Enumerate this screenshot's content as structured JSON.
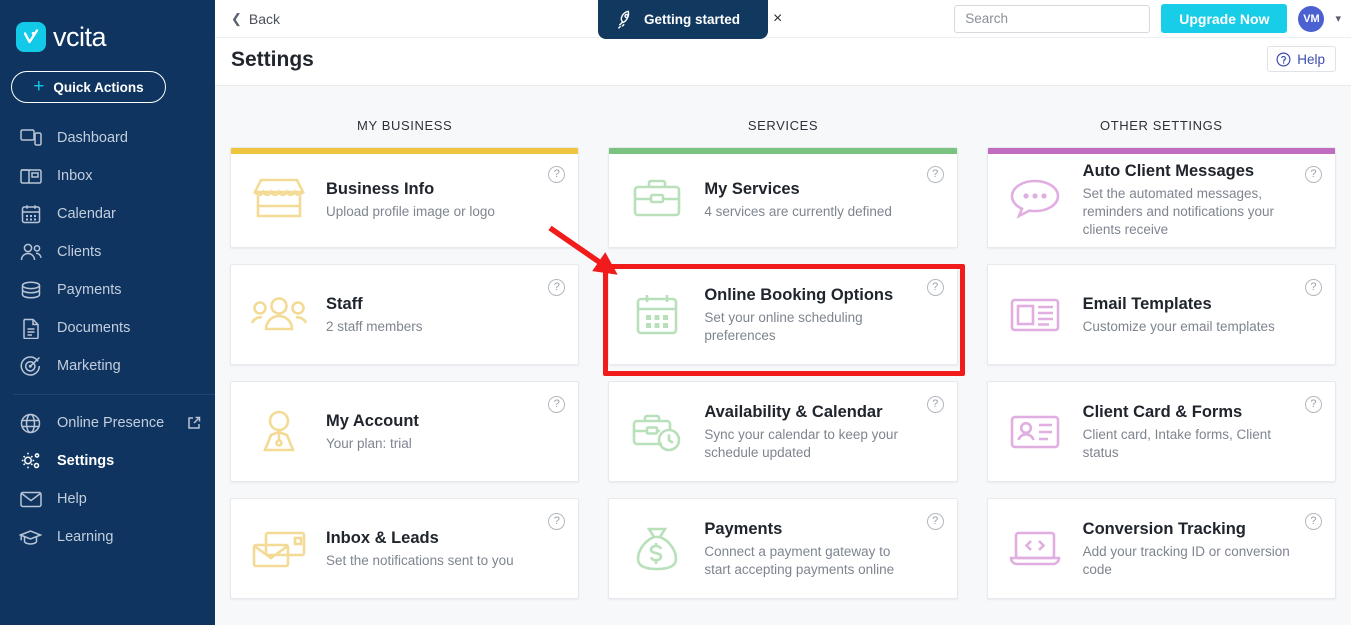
{
  "brand": {
    "name": "vcita",
    "logo_icon": "vcita-logo-icon",
    "accent": "#17cde8"
  },
  "sidebar": {
    "quick_actions": {
      "label": "Quick Actions",
      "icon": "plus-icon"
    },
    "items": [
      {
        "label": "Dashboard",
        "icon": "dashboard-icon",
        "active": false
      },
      {
        "label": "Inbox",
        "icon": "inbox-icon",
        "active": false
      },
      {
        "label": "Calendar",
        "icon": "calendar-icon",
        "active": false
      },
      {
        "label": "Clients",
        "icon": "clients-icon",
        "active": false
      },
      {
        "label": "Payments",
        "icon": "payments-icon",
        "active": false
      },
      {
        "label": "Documents",
        "icon": "documents-icon",
        "active": false
      },
      {
        "label": "Marketing",
        "icon": "marketing-icon",
        "active": false
      }
    ],
    "items2": [
      {
        "label": "Online Presence",
        "icon": "globe-icon",
        "active": false,
        "external": true
      },
      {
        "label": "Settings",
        "icon": "settings-gear-icon",
        "active": true
      },
      {
        "label": "Help",
        "icon": "envelope-icon",
        "active": false
      },
      {
        "label": "Learning",
        "icon": "graduation-cap-icon",
        "active": false
      }
    ]
  },
  "topbar": {
    "back_label": "Back",
    "back_icon": "chevron-left-icon",
    "search": {
      "placeholder": "Search",
      "value": "",
      "icon": "search-icon"
    },
    "upgrade_label": "Upgrade Now",
    "avatar_initials": "VM",
    "caret_icon": "chevron-down-icon",
    "getting_started": {
      "label": "Getting started",
      "icon": "rocket-icon",
      "close_icon": "close-icon",
      "close_label": "×"
    }
  },
  "page": {
    "title": "Settings",
    "help_label": "Help",
    "help_icon": "question-circle-icon"
  },
  "columns": [
    {
      "heading": "MY BUSINESS",
      "accent": "#efc43f",
      "cards": [
        {
          "title": "Business Info",
          "subtitle": "Upload profile image or logo",
          "icon": "storefront-icon",
          "help_icon": "question-mark-icon",
          "help_label": "?",
          "accent_bar": true
        },
        {
          "title": "Staff",
          "subtitle": "2 staff members",
          "icon": "people-group-icon",
          "help_icon": "question-mark-icon",
          "help_label": "?",
          "accent_bar": false
        },
        {
          "title": "My Account",
          "subtitle": "Your plan: trial",
          "icon": "person-suit-icon",
          "help_icon": "question-mark-icon",
          "help_label": "?",
          "accent_bar": false
        },
        {
          "title": "Inbox & Leads",
          "subtitle": "Set the notifications sent to you",
          "icon": "mail-cards-icon",
          "help_icon": "question-mark-icon",
          "help_label": "?",
          "accent_bar": false
        }
      ]
    },
    {
      "heading": "SERVICES",
      "accent": "#7ac27f",
      "cards": [
        {
          "title": "My Services",
          "subtitle": "4 services are currently defined",
          "icon": "briefcase-icon",
          "help_icon": "question-mark-icon",
          "help_label": "?",
          "accent_bar": true
        },
        {
          "title": "Online Booking Options",
          "subtitle": "Set your online scheduling preferences",
          "icon": "calendar-grid-icon",
          "help_icon": "question-mark-icon",
          "help_label": "?",
          "accent_bar": false,
          "highlighted": true
        },
        {
          "title": "Availability & Calendar",
          "subtitle": "Sync your calendar to keep your schedule updated",
          "icon": "briefcase-clock-icon",
          "help_icon": "question-mark-icon",
          "help_label": "?",
          "accent_bar": false
        },
        {
          "title": "Payments",
          "subtitle": "Connect a payment gateway to start accepting payments online",
          "icon": "money-bag-icon",
          "help_icon": "question-mark-icon",
          "help_label": "?",
          "accent_bar": false
        }
      ]
    },
    {
      "heading": "OTHER SETTINGS",
      "accent": "#c06cc0",
      "cards": [
        {
          "title": "Auto Client Messages",
          "subtitle": "Set the automated messages, reminders and notifications your clients receive",
          "icon": "chat-bubble-icon",
          "help_icon": "question-mark-icon",
          "help_label": "?",
          "accent_bar": true
        },
        {
          "title": "Email Templates",
          "subtitle": "Customize your email templates",
          "icon": "newspaper-icon",
          "help_icon": "question-mark-icon",
          "help_label": "?",
          "accent_bar": false
        },
        {
          "title": "Client Card & Forms",
          "subtitle": "Client card, Intake forms, Client status",
          "icon": "id-card-icon",
          "help_icon": "question-mark-icon",
          "help_label": "?",
          "accent_bar": false
        },
        {
          "title": "Conversion Tracking",
          "subtitle": "Add your tracking ID or conversion code",
          "icon": "laptop-code-icon",
          "help_icon": "question-mark-icon",
          "help_label": "?",
          "accent_bar": false
        }
      ]
    }
  ],
  "annotation": {
    "highlight_color": "#f21b1b",
    "arrow_icon": "red-arrow-icon",
    "target": "Online Booking Options"
  }
}
